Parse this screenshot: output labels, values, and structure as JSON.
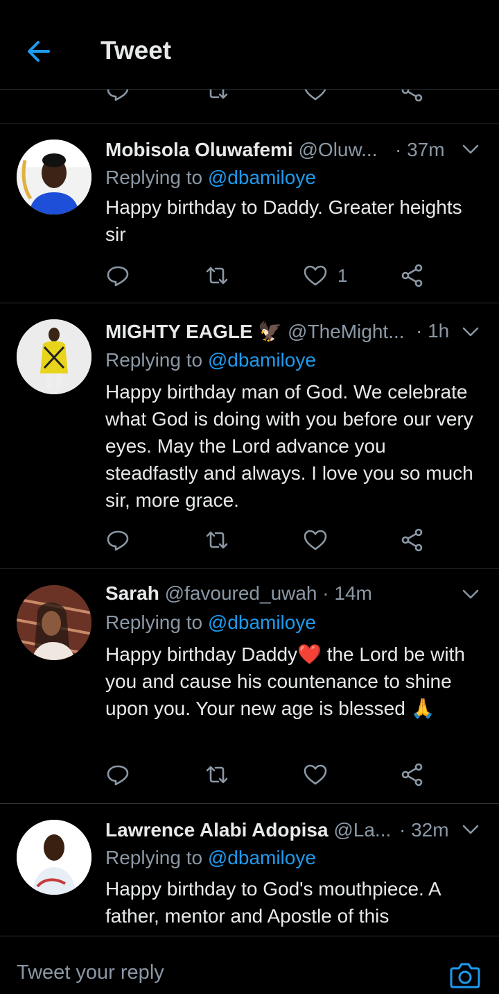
{
  "header": {
    "title": "Tweet"
  },
  "tweets": [
    {
      "name": "Mobisola Oluwafemi",
      "handle": "@Oluw...",
      "time": "· 37m",
      "replying_label": "Replying to",
      "replying_to": "@dbamiloye",
      "text": "Happy birthday to Daddy. Greater heights sir",
      "like_count": "1"
    },
    {
      "name": "MIGHTY EAGLE 🦅",
      "handle": "@TheMight...",
      "time": "· 1h",
      "replying_label": "Replying to",
      "replying_to": "@dbamiloye",
      "text": "Happy birthday man of God. We celebrate what God is doing with you before our very eyes. May the Lord advance you steadfastly and always. I love you so much sir, more grace.",
      "like_count": ""
    },
    {
      "name": "Sarah",
      "handle": "@favoured_uwah",
      "time": "· 14m",
      "replying_label": "Replying to",
      "replying_to": "@dbamiloye",
      "text": "Happy birthday Daddy❤️ the Lord be with you and cause his countenance to shine upon you. Your new age is blessed 🙏",
      "like_count": ""
    },
    {
      "name": "Lawrence Alabi Adopisa",
      "handle": "@La...",
      "time": "· 32m",
      "replying_label": "Replying to",
      "replying_to": "@dbamiloye",
      "text": "Happy birthday to God's mouthpiece. A father, mentor and Apostle of this",
      "like_count": ""
    }
  ],
  "reply_bar": {
    "placeholder": "Tweet your reply"
  },
  "colors": {
    "accent": "#1d9bf0",
    "background": "#000000",
    "muted": "#8b98a5",
    "divider": "#2f3336"
  },
  "icons": [
    "back-arrow-icon",
    "reply-icon",
    "retweet-icon",
    "like-icon",
    "share-icon",
    "chevron-down-icon",
    "camera-icon"
  ]
}
